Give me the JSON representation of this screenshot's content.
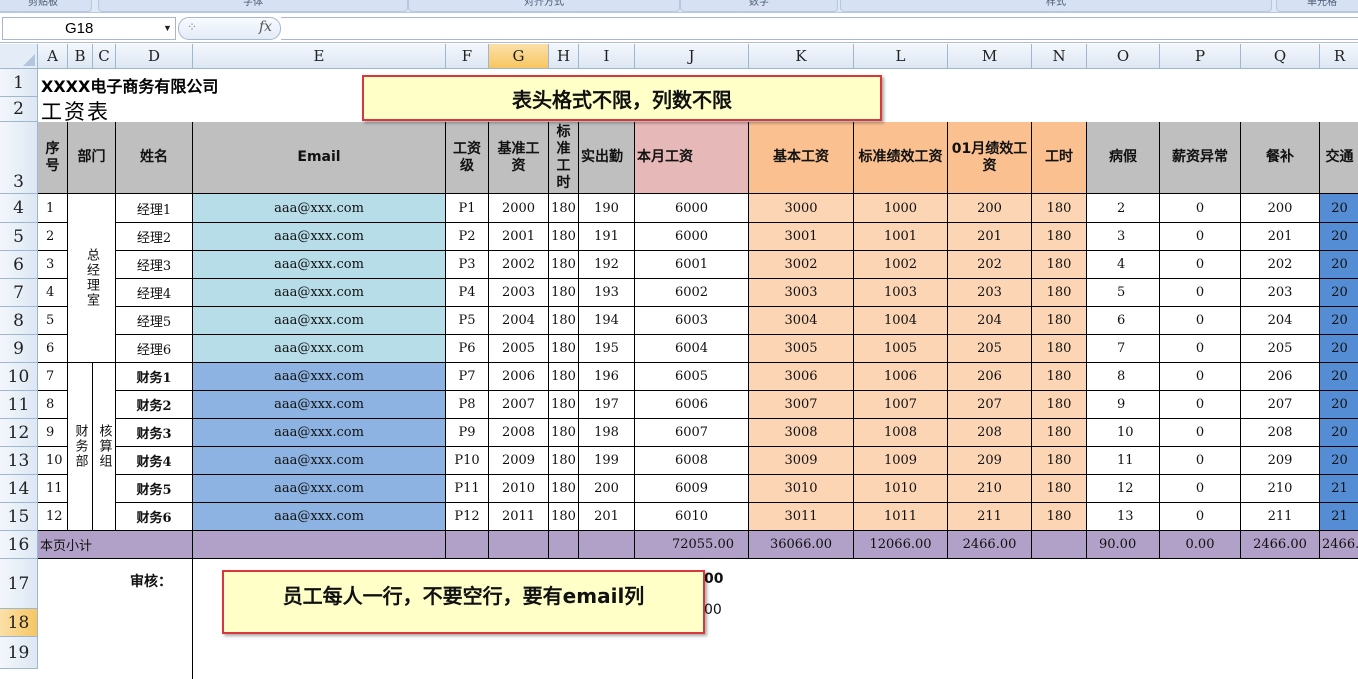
{
  "ribbon": {
    "groups": [
      "剪贴板",
      "字体",
      "对齐方式",
      "数字",
      "样式",
      "单元格"
    ]
  },
  "formula_bar": {
    "name_box": "G18",
    "fx_label": "fx",
    "formula": ""
  },
  "selected": {
    "column": "G",
    "row": "18"
  },
  "columns": [
    "A",
    "B",
    "C",
    "D",
    "E",
    "F",
    "G",
    "H",
    "I",
    "J",
    "K",
    "L",
    "M",
    "N",
    "O",
    "P",
    "Q",
    "R"
  ],
  "rows": [
    "1",
    "2",
    "3",
    "4",
    "5",
    "6",
    "7",
    "8",
    "9",
    "10",
    "11",
    "12",
    "13",
    "14",
    "15",
    "16",
    "17",
    "18",
    "19"
  ],
  "sheet": {
    "company": "XXXX电子商务有限公司",
    "title": "工资表",
    "headers": {
      "seq": "序号",
      "dept": "部门",
      "name": "姓名",
      "email": "Email",
      "grade": "工资级",
      "base_wage": "基准工资",
      "std_hours": "标准工时",
      "attendance": "实出勤",
      "month_wage": "本月工资",
      "basic_wage": "基本工资",
      "std_perf": "标准绩效工资",
      "jan_perf": "01月绩效工资",
      "hours": "工时",
      "sick": "病假",
      "abnormal": "薪资异常",
      "meal": "餐补",
      "transport": "交通"
    },
    "dept_groups": {
      "gm_office": "总经理室",
      "finance": "财务部",
      "accounting": "核算组"
    },
    "employees": [
      {
        "seq": "1",
        "name": "经理1",
        "email": "aaa@xxx.com",
        "grade": "P1",
        "base": "2000",
        "std": "180",
        "att": "190",
        "wage": "6000",
        "basic": "3000",
        "perf": "1000",
        "jan": "200",
        "hours": "180",
        "sick": "2",
        "abn": "0",
        "meal": "200",
        "trans": "20"
      },
      {
        "seq": "2",
        "name": "经理2",
        "email": "aaa@xxx.com",
        "grade": "P2",
        "base": "2001",
        "std": "180",
        "att": "191",
        "wage": "6000",
        "basic": "3001",
        "perf": "1001",
        "jan": "201",
        "hours": "180",
        "sick": "3",
        "abn": "0",
        "meal": "201",
        "trans": "20"
      },
      {
        "seq": "3",
        "name": "经理3",
        "email": "aaa@xxx.com",
        "grade": "P3",
        "base": "2002",
        "std": "180",
        "att": "192",
        "wage": "6001",
        "basic": "3002",
        "perf": "1002",
        "jan": "202",
        "hours": "180",
        "sick": "4",
        "abn": "0",
        "meal": "202",
        "trans": "20"
      },
      {
        "seq": "4",
        "name": "经理4",
        "email": "aaa@xxx.com",
        "grade": "P4",
        "base": "2003",
        "std": "180",
        "att": "193",
        "wage": "6002",
        "basic": "3003",
        "perf": "1003",
        "jan": "203",
        "hours": "180",
        "sick": "5",
        "abn": "0",
        "meal": "203",
        "trans": "20"
      },
      {
        "seq": "5",
        "name": "经理5",
        "email": "aaa@xxx.com",
        "grade": "P5",
        "base": "2004",
        "std": "180",
        "att": "194",
        "wage": "6003",
        "basic": "3004",
        "perf": "1004",
        "jan": "204",
        "hours": "180",
        "sick": "6",
        "abn": "0",
        "meal": "204",
        "trans": "20"
      },
      {
        "seq": "6",
        "name": "经理6",
        "email": "aaa@xxx.com",
        "grade": "P6",
        "base": "2005",
        "std": "180",
        "att": "195",
        "wage": "6004",
        "basic": "3005",
        "perf": "1005",
        "jan": "205",
        "hours": "180",
        "sick": "7",
        "abn": "0",
        "meal": "205",
        "trans": "20"
      },
      {
        "seq": "7",
        "name": "财务1",
        "email": "aaa@xxx.com",
        "grade": "P7",
        "base": "2006",
        "std": "180",
        "att": "196",
        "wage": "6005",
        "basic": "3006",
        "perf": "1006",
        "jan": "206",
        "hours": "180",
        "sick": "8",
        "abn": "0",
        "meal": "206",
        "trans": "20"
      },
      {
        "seq": "8",
        "name": "财务2",
        "email": "aaa@xxx.com",
        "grade": "P8",
        "base": "2007",
        "std": "180",
        "att": "197",
        "wage": "6006",
        "basic": "3007",
        "perf": "1007",
        "jan": "207",
        "hours": "180",
        "sick": "9",
        "abn": "0",
        "meal": "207",
        "trans": "20"
      },
      {
        "seq": "9",
        "name": "财务3",
        "email": "aaa@xxx.com",
        "grade": "P9",
        "base": "2008",
        "std": "180",
        "att": "198",
        "wage": "6007",
        "basic": "3008",
        "perf": "1008",
        "jan": "208",
        "hours": "180",
        "sick": "10",
        "abn": "0",
        "meal": "208",
        "trans": "20"
      },
      {
        "seq": "10",
        "name": "财务4",
        "email": "aaa@xxx.com",
        "grade": "P10",
        "base": "2009",
        "std": "180",
        "att": "199",
        "wage": "6008",
        "basic": "3009",
        "perf": "1009",
        "jan": "209",
        "hours": "180",
        "sick": "11",
        "abn": "0",
        "meal": "209",
        "trans": "20"
      },
      {
        "seq": "11",
        "name": "财务5",
        "email": "aaa@xxx.com",
        "grade": "P11",
        "base": "2010",
        "std": "180",
        "att": "200",
        "wage": "6009",
        "basic": "3010",
        "perf": "1010",
        "jan": "210",
        "hours": "180",
        "sick": "12",
        "abn": "0",
        "meal": "210",
        "trans": "21"
      },
      {
        "seq": "12",
        "name": "财务6",
        "email": "aaa@xxx.com",
        "grade": "P12",
        "base": "2011",
        "std": "180",
        "att": "201",
        "wage": "6010",
        "basic": "3011",
        "perf": "1011",
        "jan": "211",
        "hours": "180",
        "sick": "13",
        "abn": "0",
        "meal": "211",
        "trans": "21"
      }
    ],
    "subtotal": {
      "label": "本页小计",
      "wage": "72055.00",
      "basic": "36066.00",
      "perf": "12066.00",
      "jan": "2466.00",
      "sick": "90.00",
      "abn": "0.00",
      "meal": "2466.00",
      "trans": "2466."
    },
    "reviewer_label": "审核：",
    "partial_cells": {
      "row17": "00",
      "row18": "00"
    }
  },
  "callouts": {
    "top": "表头格式不限，列数不限",
    "bottom": "员工每人一行，不要空行，要有email列"
  },
  "colors": {
    "email_light": "#b7dde8",
    "email_dark": "#8db3e2",
    "header_gray": "#bfbfbf",
    "header_pink": "#e6b8b7",
    "header_orange": "#fac090",
    "body_peach": "#fcd5b4",
    "subtotal_purple": "#b1a0c7",
    "transport_blue": "#548dd4"
  }
}
